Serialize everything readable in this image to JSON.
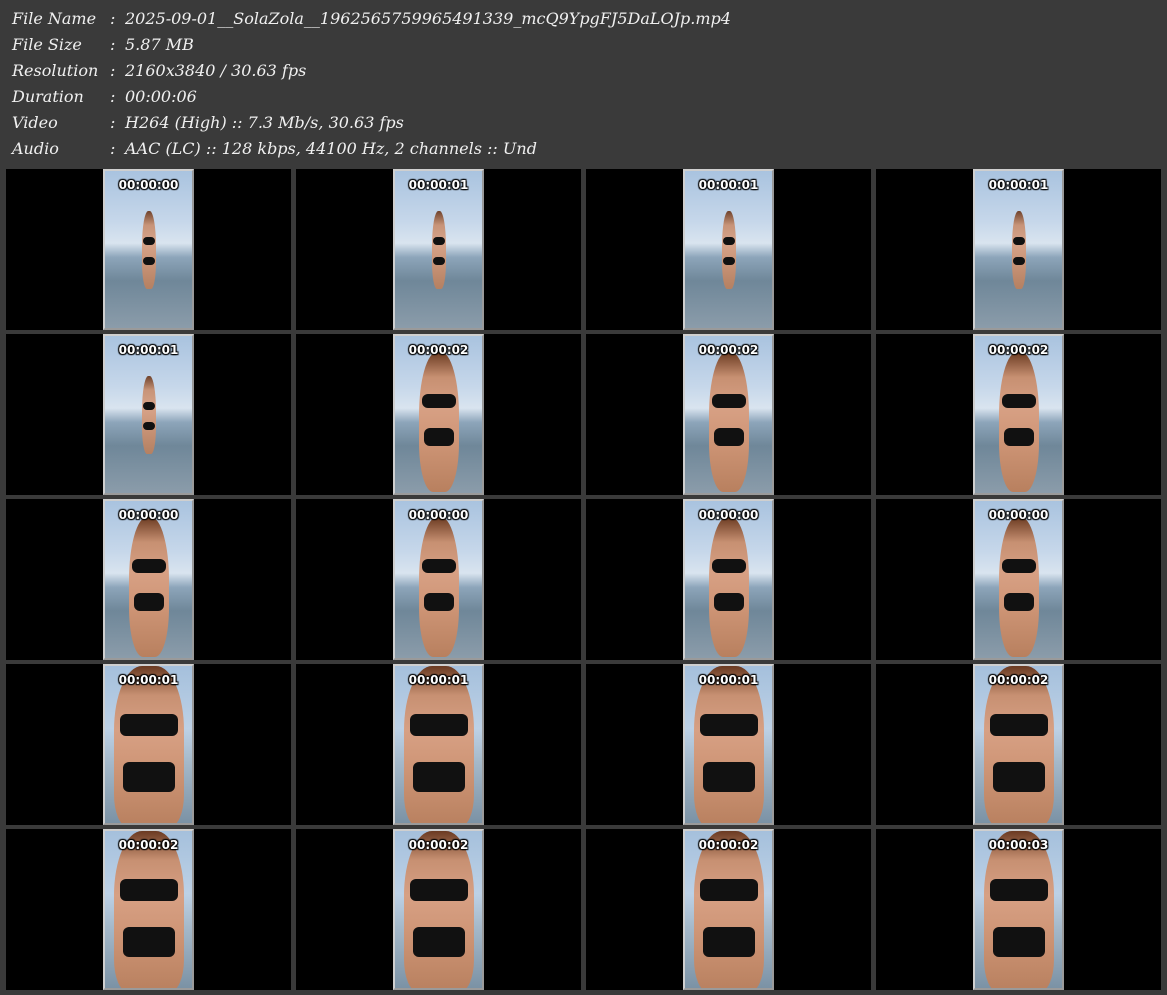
{
  "metadata": [
    {
      "label": "File Name",
      "value": "2025-09-01__SolaZola__1962565759965491339_mcQ9YpgFJ5DaLOJp.mp4"
    },
    {
      "label": "File Size",
      "value": "5.87 MB"
    },
    {
      "label": "Resolution",
      "value": "2160x3840 / 30.63 fps"
    },
    {
      "label": "Duration",
      "value": "00:00:06"
    },
    {
      "label": "Video",
      "value": "H264 (High) :: 7.3 Mb/s, 30.63 fps"
    },
    {
      "label": "Audio",
      "value": "AAC (LC) :: 128 kbps, 44100 Hz, 2 channels :: Und"
    }
  ],
  "separator": ":",
  "thumbnails": [
    {
      "timestamp": "00:00:00",
      "framing": "far"
    },
    {
      "timestamp": "00:00:01",
      "framing": "far"
    },
    {
      "timestamp": "00:00:01",
      "framing": "far"
    },
    {
      "timestamp": "00:00:01",
      "framing": "far"
    },
    {
      "timestamp": "00:00:01",
      "framing": "far"
    },
    {
      "timestamp": "00:00:02",
      "framing": "mid"
    },
    {
      "timestamp": "00:00:02",
      "framing": "mid"
    },
    {
      "timestamp": "00:00:02",
      "framing": "mid"
    },
    {
      "timestamp": "00:00:00",
      "framing": "mid"
    },
    {
      "timestamp": "00:00:00",
      "framing": "mid"
    },
    {
      "timestamp": "00:00:00",
      "framing": "mid"
    },
    {
      "timestamp": "00:00:00",
      "framing": "mid"
    },
    {
      "timestamp": "00:00:01",
      "framing": "close"
    },
    {
      "timestamp": "00:00:01",
      "framing": "close"
    },
    {
      "timestamp": "00:00:01",
      "framing": "close"
    },
    {
      "timestamp": "00:00:02",
      "framing": "close"
    },
    {
      "timestamp": "00:00:02",
      "framing": "close"
    },
    {
      "timestamp": "00:00:02",
      "framing": "close"
    },
    {
      "timestamp": "00:00:02",
      "framing": "close"
    },
    {
      "timestamp": "00:00:03",
      "framing": "close"
    }
  ]
}
